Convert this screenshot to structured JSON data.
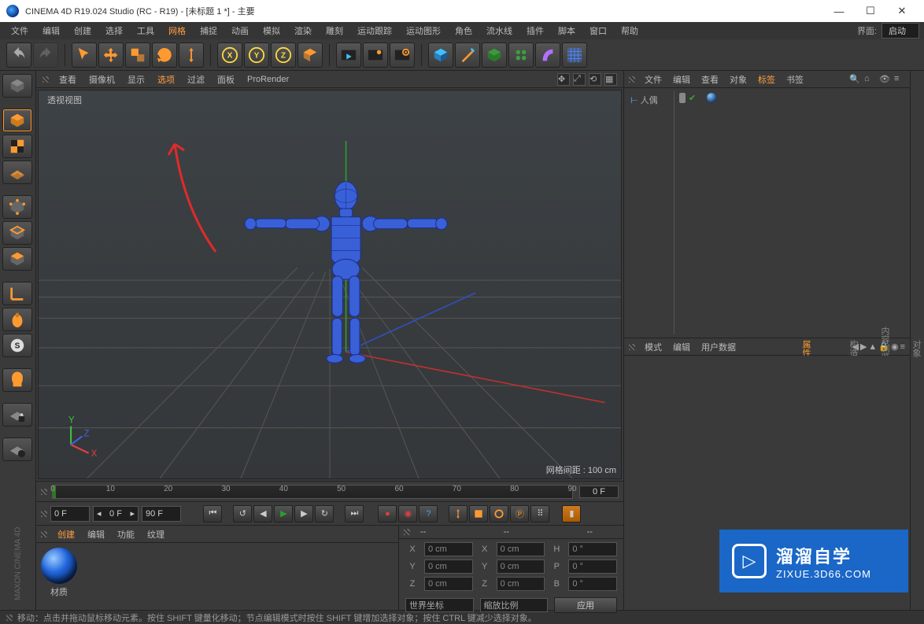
{
  "title": "CINEMA 4D R19.024 Studio (RC - R19) - [未标题 1 *] - 主要",
  "menu": [
    "文件",
    "编辑",
    "创建",
    "选择",
    "工具",
    "网格",
    "捕捉",
    "动画",
    "模拟",
    "渲染",
    "雕刻",
    "运动跟踪",
    "运动图形",
    "角色",
    "流水线",
    "插件",
    "脚本",
    "窗口",
    "帮助"
  ],
  "menu_active_index": 5,
  "layout": {
    "label": "界面:",
    "value": "启动"
  },
  "vp_menu": [
    "查看",
    "摄像机",
    "显示",
    "选项",
    "过滤",
    "面板",
    "ProRender"
  ],
  "vp_menu_hi_index": 3,
  "vp_label": "透视视图",
  "vp_gridinfo": "网格间距 : 100 cm",
  "timeline": {
    "ticks": [
      "0",
      "10",
      "20",
      "30",
      "40",
      "50",
      "60",
      "70",
      "80",
      "90"
    ],
    "current": "0 F"
  },
  "playback": {
    "start": "0 F",
    "cur": "0 F",
    "end": "90 F"
  },
  "mat_menu": [
    "创建",
    "编辑",
    "功能",
    "纹理"
  ],
  "mat_menu_hi": 0,
  "mat_name": "材质",
  "coord": {
    "head": [
      "--",
      "--",
      "--"
    ],
    "rows": [
      {
        "axis": "X",
        "pos": "0 cm",
        "axis2": "X",
        "size": "0 cm",
        "axis3": "H",
        "rot": "0 °"
      },
      {
        "axis": "Y",
        "pos": "0 cm",
        "axis2": "Y",
        "size": "0 cm",
        "axis3": "P",
        "rot": "0 °"
      },
      {
        "axis": "Z",
        "pos": "0 cm",
        "axis2": "Z",
        "size": "0 cm",
        "axis3": "B",
        "rot": "0 °"
      }
    ],
    "space": "世界坐标",
    "scale": "缩放比例",
    "apply": "应用"
  },
  "obj_menu": [
    "文件",
    "编辑",
    "查看",
    "对象",
    "标签",
    "书签"
  ],
  "obj_menu_hi": 4,
  "obj_item": "人偶",
  "attr_menu": [
    "模式",
    "编辑",
    "用户数据"
  ],
  "statusbar": "移动：点击并拖动鼠标移动元素。按住 SHIFT 键量化移动；节点编辑模式时按住 SHIFT 键增加选择对象；按住 CTRL 键减少选择对象。",
  "right_tabs": [
    "对象",
    "内容浏览器",
    "构造"
  ],
  "attr_tab": "属性",
  "watermark": {
    "big": "溜溜自学",
    "small": "ZIXUE.3D66.COM"
  },
  "maxon": "MAXON CINEMA 4D"
}
